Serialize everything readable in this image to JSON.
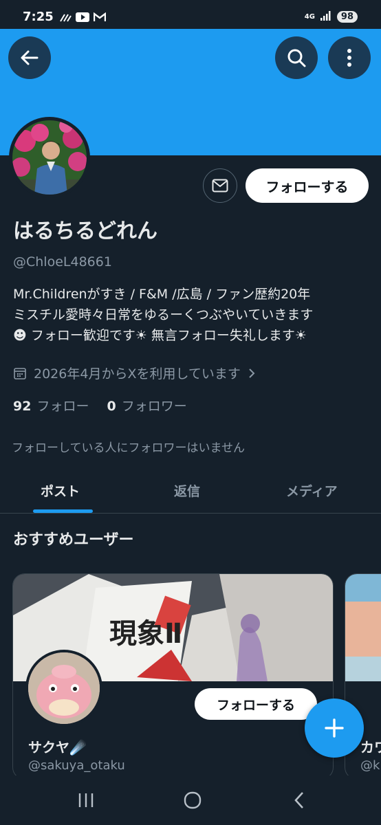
{
  "status_bar": {
    "time": "7:25",
    "network": "4G",
    "battery": "98"
  },
  "header": {
    "back": "back",
    "search": "search",
    "more": "more"
  },
  "profile": {
    "display_name": "はるちるどれん",
    "handle": "@ChloeL48661",
    "bio_line1": "Mr.Childrenがすき / F&M /広島 / ファン歴約20年",
    "bio_line2": "ミスチル愛時々日常をゆるーくつぶやいていきます",
    "bio_line3": "☻ フォロー歓迎です☀︎ 無言フォロー失礼します☀︎",
    "joined": "2026年4月からXを利用しています",
    "following_count": "92",
    "following_label": "フォロー",
    "followers_count": "0",
    "followers_label": "フォロワー",
    "no_mutual": "フォローしている人にフォロワーはいません",
    "follow_button": "フォローする"
  },
  "tabs": [
    {
      "label": "ポスト",
      "active": true
    },
    {
      "label": "返信",
      "active": false
    },
    {
      "label": "メディア",
      "active": false
    }
  ],
  "recommended": {
    "title": "おすすめユーザー",
    "cards": [
      {
        "name": "サクヤ☄️",
        "handle": "@sakuya_otaku",
        "follow": "フォローする"
      },
      {
        "name": "カワ",
        "handle": "@k"
      }
    ]
  },
  "colors": {
    "accent": "#1d9bf0",
    "background": "#15202b",
    "muted": "#8b98a5"
  }
}
